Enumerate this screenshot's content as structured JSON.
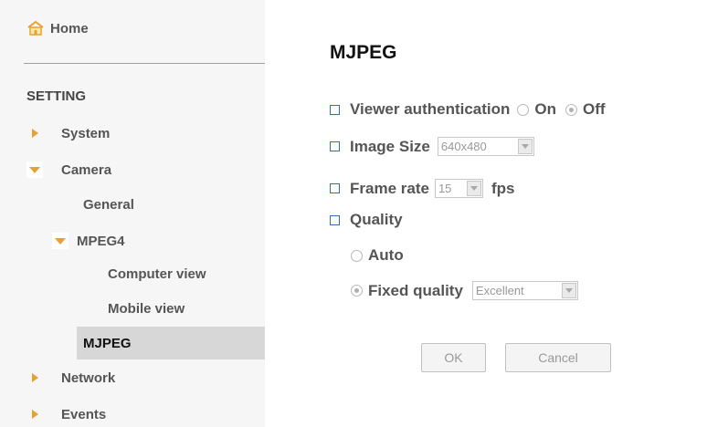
{
  "sidebar": {
    "home_label": "Home",
    "setting_title": "SETTING",
    "items": {
      "system": "System",
      "camera": "Camera",
      "general": "General",
      "mpeg4": "MPEG4",
      "computer_view": "Computer view",
      "mobile_view": "Mobile view",
      "mjpeg": "MJPEG",
      "network": "Network",
      "events": "Events"
    }
  },
  "main": {
    "title": "MJPEG",
    "viewer_auth": {
      "label": "Viewer authentication",
      "on_label": "On",
      "off_label": "Off",
      "selected": "Off"
    },
    "image_size": {
      "label": "Image Size",
      "value": "640x480"
    },
    "frame_rate": {
      "label": "Frame rate",
      "value": "15",
      "unit": "fps"
    },
    "quality": {
      "label": "Quality",
      "auto_label": "Auto",
      "fixed_label": "Fixed quality",
      "fixed_value": "Excellent",
      "selected": "Fixed quality"
    },
    "ok_label": "OK",
    "cancel_label": "Cancel"
  },
  "colors": {
    "accent_arrow": "#e8a030",
    "bullet_border": "#2f6fb3",
    "active_bg": "#d7d7d7"
  }
}
